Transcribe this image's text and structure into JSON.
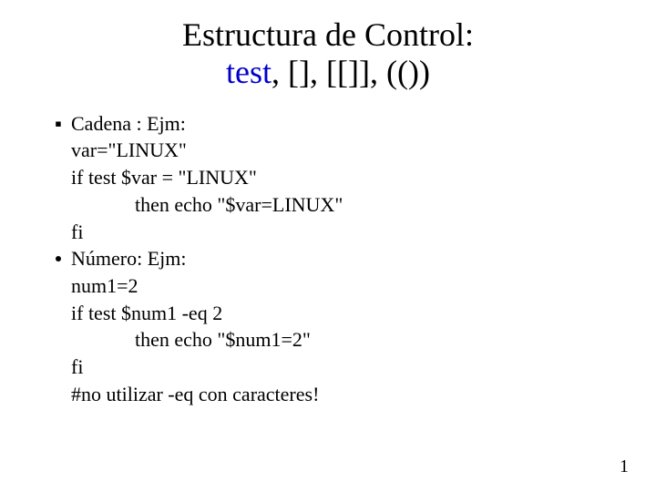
{
  "title": {
    "line1": "Estructura de Control:",
    "keyword": "test",
    "suffix": ", [], [[]], (())"
  },
  "lines": [
    {
      "bullet": "square",
      "text": "Cadena : Ejm:",
      "indent": false
    },
    {
      "bullet": "",
      "text": "var=\"LINUX\"",
      "indent": false
    },
    {
      "bullet": "",
      "text": "if test $var  = \"LINUX\"",
      "indent": false
    },
    {
      "bullet": "",
      "text": "then echo \"$var=LINUX\"",
      "indent": true
    },
    {
      "bullet": "",
      "text": "fi",
      "indent": false
    },
    {
      "bullet": "disc",
      "text": "Número: Ejm:",
      "indent": false
    },
    {
      "bullet": "",
      "text": "num1=2",
      "indent": false
    },
    {
      "bullet": "",
      "text": "if test $num1 -eq 2",
      "indent": false
    },
    {
      "bullet": "",
      "text": "then echo \"$num1=2\"",
      "indent": true
    },
    {
      "bullet": "",
      "text": "fi",
      "indent": false
    },
    {
      "bullet": "",
      "text": "#no utilizar -eq con caracteres!",
      "indent": false
    }
  ],
  "pageNumber": "1"
}
